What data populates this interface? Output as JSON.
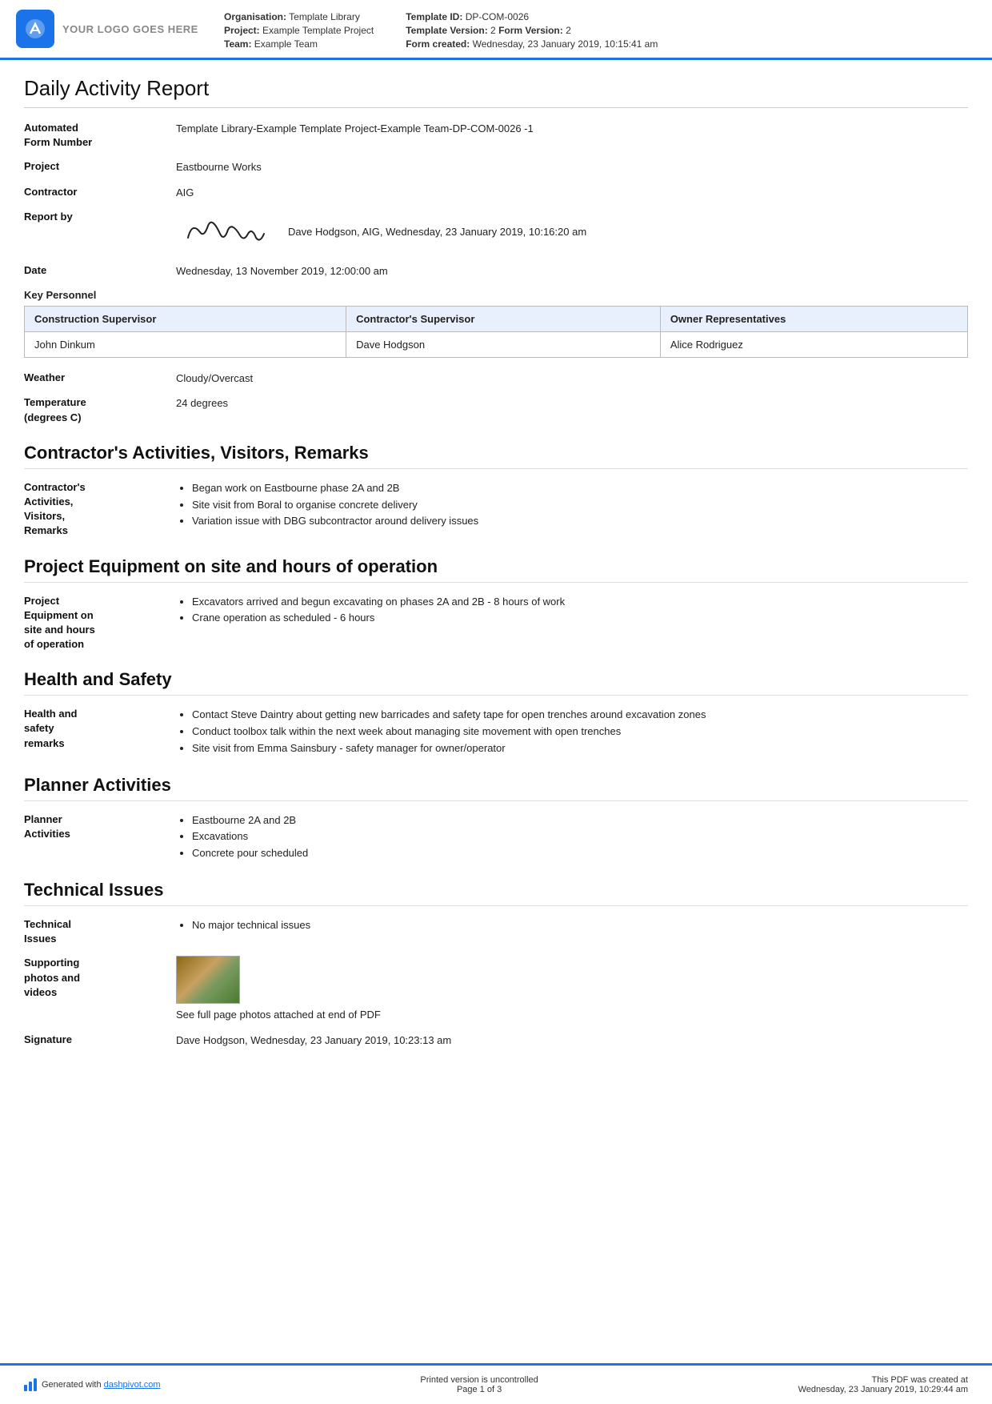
{
  "header": {
    "logo_text": "YOUR LOGO GOES HERE",
    "org_label": "Organisation:",
    "org_value": "Template Library",
    "project_label": "Project:",
    "project_value": "Example Template Project",
    "team_label": "Team:",
    "team_value": "Example Team",
    "template_id_label": "Template ID:",
    "template_id_value": "DP-COM-0026",
    "template_version_label": "Template Version:",
    "template_version_value": "2",
    "form_version_label": "Form Version:",
    "form_version_value": "2",
    "form_created_label": "Form created:",
    "form_created_value": "Wednesday, 23 January 2019, 10:15:41 am"
  },
  "report": {
    "title": "Daily Activity Report",
    "automated_label": "Automated\nForm Number",
    "automated_value": "Template Library-Example Template Project-Example Team-DP-COM-0026   -1",
    "project_label": "Project",
    "project_value": "Eastbourne Works",
    "contractor_label": "Contractor",
    "contractor_value": "AIG",
    "report_by_label": "Report by",
    "report_by_value": "Dave Hodgson, AIG, Wednesday, 23 January 2019, 10:16:20 am",
    "date_label": "Date",
    "date_value": "Wednesday, 13 November 2019, 12:00:00 am",
    "key_personnel_label": "Key Personnel",
    "personnel_table": {
      "headers": [
        "Construction Supervisor",
        "Contractor's Supervisor",
        "Owner Representatives"
      ],
      "rows": [
        [
          "John Dinkum",
          "Dave Hodgson",
          "Alice Rodriguez"
        ]
      ]
    },
    "weather_label": "Weather",
    "weather_value": "Cloudy/Overcast",
    "temperature_label": "Temperature\n(degrees C)",
    "temperature_value": "24 degrees"
  },
  "sections": {
    "contractors": {
      "heading": "Contractor's Activities, Visitors, Remarks",
      "field_label": "Contractor's\nActivities,\nVisitors,\nRemarks",
      "items": [
        "Began work on Eastbourne phase 2A and 2B",
        "Site visit from Boral to organise concrete delivery",
        "Variation issue with DBG subcontractor around delivery issues"
      ]
    },
    "equipment": {
      "heading": "Project Equipment on site and hours of operation",
      "field_label": "Project\nEquipment on\nsite and hours\nof operation",
      "items": [
        "Excavators arrived and begun excavating on phases 2A and 2B - 8 hours of work",
        "Crane operation as scheduled - 6 hours"
      ]
    },
    "health": {
      "heading": "Health and Safety",
      "field_label": "Health and\nsafety\nremarks",
      "items": [
        "Contact Steve Daintry about getting new barricades and safety tape for open trenches around excavation zones",
        "Conduct toolbox talk within the next week about managing site movement with open trenches",
        "Site visit from Emma Sainsbury - safety manager for owner/operator"
      ]
    },
    "planner": {
      "heading": "Planner Activities",
      "field_label": "Planner\nActivities",
      "items": [
        "Eastbourne 2A and 2B",
        "Excavations",
        "Concrete pour scheduled"
      ]
    },
    "technical": {
      "heading": "Technical Issues",
      "field_label": "Technical\nIssues",
      "items": [
        "No major technical issues"
      ],
      "photos_label": "Supporting\nphotos and\nvideos",
      "photos_caption": "See full page photos attached at end of PDF",
      "signature_label": "Signature",
      "signature_value": "Dave Hodgson, Wednesday, 23 January 2019, 10:23:13 am"
    }
  },
  "footer": {
    "generated_text": "Generated with ",
    "generated_link": "dashpivot.com",
    "center_text": "Printed version is uncontrolled",
    "page_text": "Page 1 of 3",
    "right_text": "This PDF was created at",
    "right_date": "Wednesday, 23 January 2019, 10:29:44 am"
  }
}
